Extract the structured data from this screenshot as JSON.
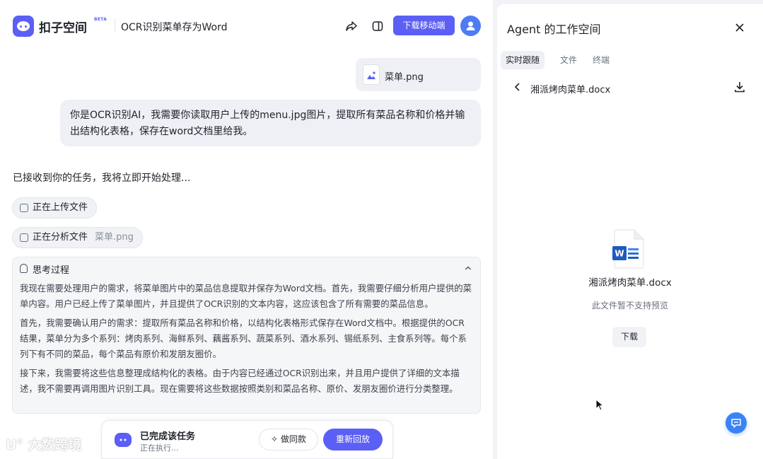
{
  "header": {
    "brand": "扣子空间",
    "beta": "BETA",
    "title": "OCR识别菜单存为Word",
    "download_button": "下载移动端"
  },
  "conversation": {
    "attachment_name": "菜单.png",
    "user_message": "你是OCR识别AI，我需要你读取用户上传的menu.jpg图片，提取所有菜品名称和价格并输出结构化表格，保存在word文档里给我。",
    "agent_reply": "已接收到你的任务，我将立即开始处理...",
    "steps": [
      {
        "label": "正在上传文件",
        "detail": ""
      },
      {
        "label": "正在分析文件",
        "detail": "菜单.png"
      }
    ],
    "thinking": {
      "title": "思考过程",
      "paragraphs": [
        "我现在需要处理用户的需求，将菜单图片中的菜品信息提取并保存为Word文档。首先，我需要仔细分析用户提供的菜单内容。用户已经上传了菜单图片，并且提供了OCR识别的文本内容，这应该包含了所有需要的菜品信息。",
        "首先，我需要确认用户的需求：提取所有菜品名称和价格，以结构化表格形式保存在Word文档中。根据提供的OCR结果，菜单分为多个系列：烤肉系列、海鲜系列、藕酱系列、蔬菜系列、酒水系列、锡纸系列、主食系列等。每个系列下有不同的菜品，每个菜品有原价和发朋友圈价。",
        "接下来，我需要将这些信息整理成结构化的表格。由于内容已经通过OCR识别出来，并且用户提供了详细的文本描述，我不需要再调用图片识别工具。现在需要将这些数据按照类别和菜品名称、原价、发朋友圈价进行分类整理。"
      ]
    }
  },
  "bottom_bar": {
    "status": "已完成该任务",
    "substatus": "正在执行...",
    "same_button": "做同款",
    "replay_button": "重新回放"
  },
  "watermark": "大数跨境",
  "workspace": {
    "title": "Agent 的工作空间",
    "tabs": [
      "实时跟随",
      "文件",
      "终端"
    ],
    "active_tab": "实时跟随",
    "file_path": "湘派烤肉菜单.docx",
    "preview_name": "湘派烤肉菜单.docx",
    "preview_note": "此文件暂不支持预览",
    "download_label": "下载"
  },
  "colors": {
    "accent": "#5b5ff5",
    "feedback": "#3b82f6",
    "word_blue": "#1e5bbf"
  }
}
